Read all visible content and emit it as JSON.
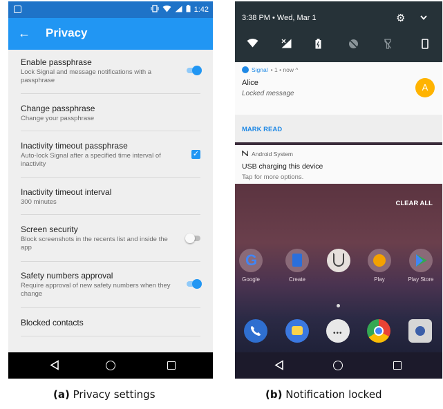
{
  "left_phone": {
    "status_bar": {
      "time": "1:42"
    },
    "app_bar": {
      "title": "Privacy"
    },
    "preferences": [
      {
        "title": "Enable passphrase",
        "summary": "Lock Signal and message notifications with a passphrase",
        "widget": "toggle-on"
      },
      {
        "title": "Change passphrase",
        "summary": "Change your passphrase",
        "widget": "none"
      },
      {
        "title": "Inactivity timeout passphrase",
        "summary": "Auto-lock Signal after a specified time interval of inactivity",
        "widget": "checkbox-checked"
      },
      {
        "title": "Inactivity timeout interval",
        "summary": "300 minutes",
        "widget": "none"
      },
      {
        "title": "Screen security",
        "summary": "Block screenshots in the recents list and inside the app",
        "widget": "toggle-off"
      },
      {
        "title": "Safety numbers approval",
        "summary": "Require approval of new safety numbers when they change",
        "widget": "toggle-on"
      },
      {
        "title": "Blocked contacts",
        "summary": "",
        "widget": "none"
      }
    ]
  },
  "right_phone": {
    "quick_settings": {
      "datetime": "3:38 PM • Wed, Mar 1"
    },
    "signal_notification": {
      "app": "Signal",
      "meta": "• 1 • now ^",
      "sender": "Alice",
      "text": "Locked message",
      "avatar_letter": "A",
      "action": "MARK READ"
    },
    "system_notification": {
      "app": "Android System",
      "title": "USB charging this device",
      "text": "Tap for more options."
    },
    "home": {
      "clear_all": "CLEAR ALL",
      "apps": [
        "Google",
        "Create",
        "",
        "Play",
        "Play Store"
      ]
    }
  },
  "captions": [
    {
      "label": "(a)",
      "text": "Privacy settings"
    },
    {
      "label": "(b)",
      "text": "Notification locked"
    }
  ],
  "colors": {
    "accent": "#2196f3",
    "status_bar": "#1e73c8",
    "avatar": "#ffb300",
    "notification_action": "#1e88e5"
  }
}
